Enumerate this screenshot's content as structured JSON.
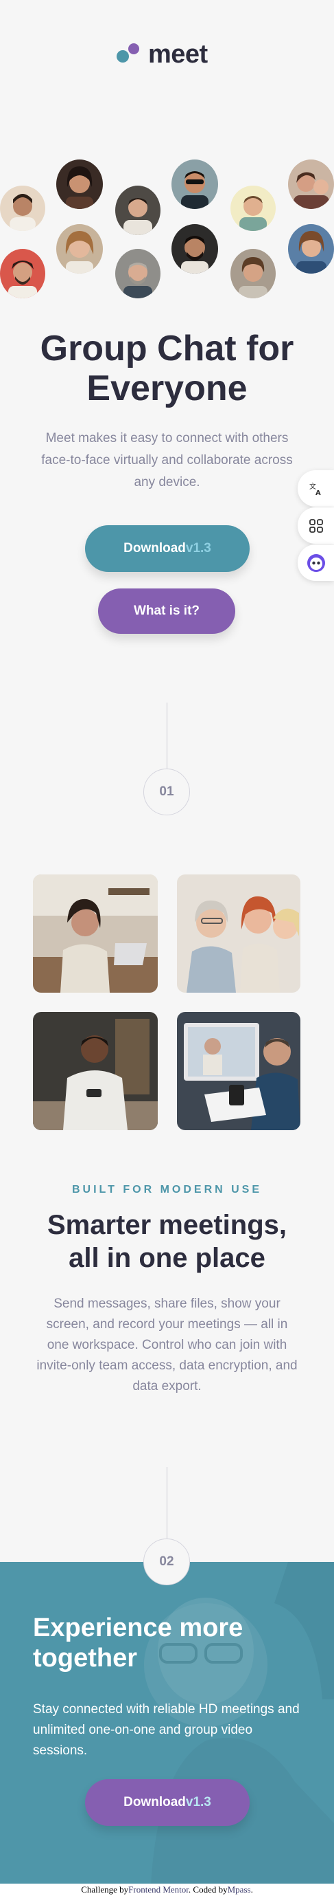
{
  "header": {
    "logo_text": "meet"
  },
  "hero": {
    "title_line1": "Group Chat for",
    "title_line2": "Everyone",
    "description": "Meet makes it easy to connect with others face-to-face virtually and collaborate across any device.",
    "download_label": "Download",
    "download_version": "v1.3",
    "what_label": "What is it?"
  },
  "side_tools": [
    "translate-icon",
    "apps-grid-icon",
    "assistant-bot-icon"
  ],
  "steps": {
    "first": "01",
    "second": "02"
  },
  "features": {
    "eyebrow": "BUILT FOR MODERN USE",
    "title_line1": "Smarter meetings,",
    "title_line2": "all in one place",
    "description": "Send messages, share files, show your screen, and record your meetings — all in one workspace. Control who can join with invite-only team access, data encryption, and data export."
  },
  "cta": {
    "title_line1": "Experience more",
    "title_line2": "together",
    "description": "Stay connected with reliable HD meetings and unlimited one-on-one and group video sessions.",
    "download_label": "Download",
    "download_version": "v1.3"
  },
  "footer": {
    "challenge_prefix": "Challenge by",
    "challenge_link": "Frontend Mentor",
    "coded_prefix": ". Coded by",
    "coded_link": "Mpass",
    "suffix": "."
  },
  "colors": {
    "teal": "#4d96a9",
    "purple": "#855fb1",
    "dark": "#2d2d3e",
    "muted": "#87879d"
  }
}
